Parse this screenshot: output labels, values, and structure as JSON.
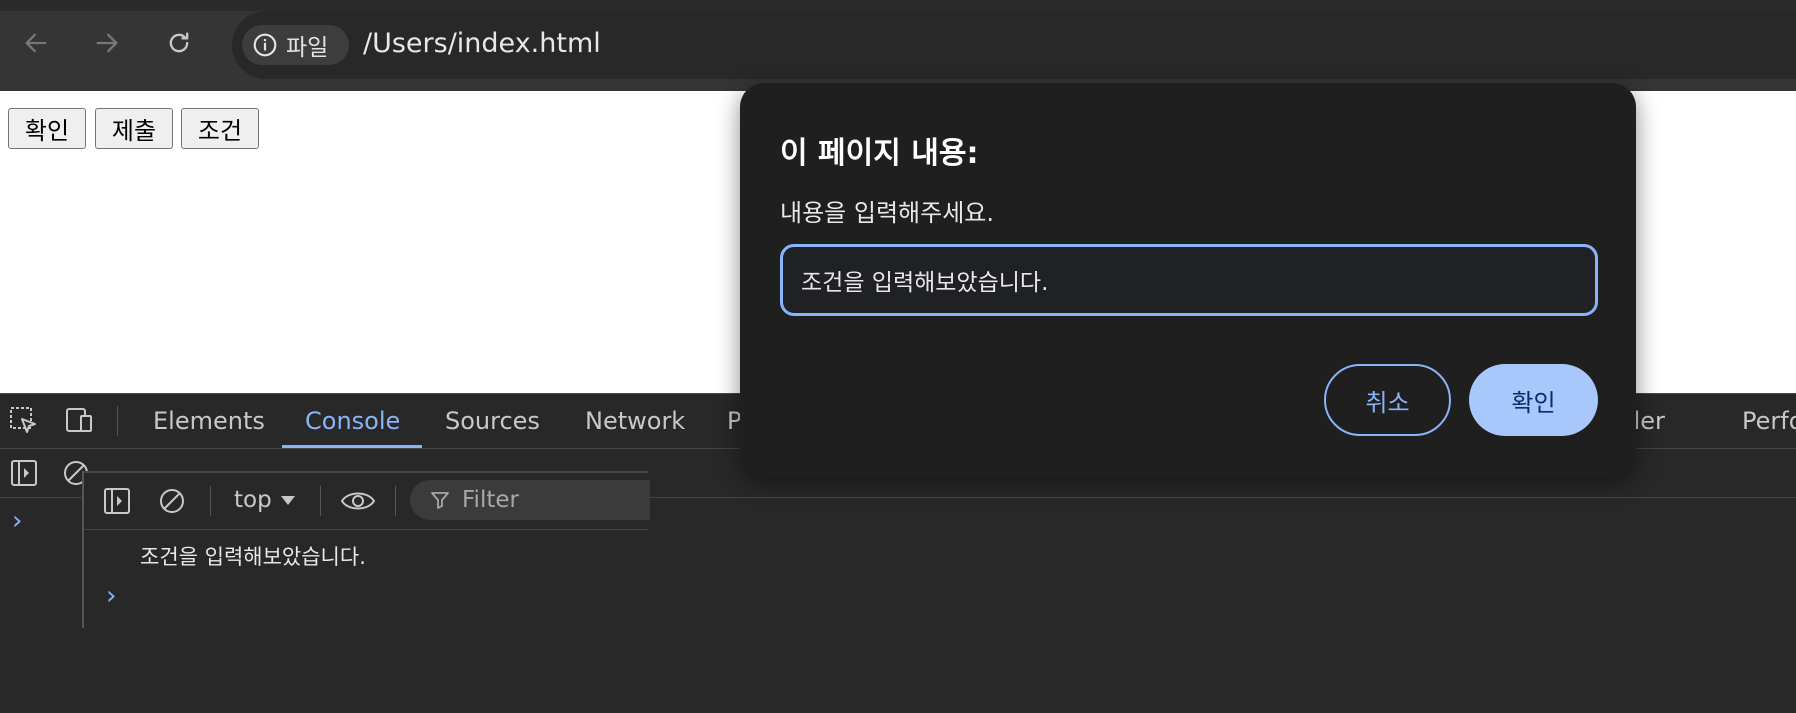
{
  "browser": {
    "back_icon": "arrow-left-icon",
    "forward_icon": "arrow-right-icon",
    "reload_icon": "reload-icon",
    "site_info": {
      "icon": "info-icon",
      "label": "파일"
    },
    "url": "/Users/index.html"
  },
  "page": {
    "buttons": [
      {
        "label": "확인"
      },
      {
        "label": "제출"
      },
      {
        "label": "조건"
      }
    ]
  },
  "devtools": {
    "tabs": [
      {
        "label": "Elements"
      },
      {
        "label": "Console",
        "active": true
      },
      {
        "label": "Sources"
      },
      {
        "label": "Network"
      },
      {
        "label": "P"
      },
      {
        "label": "der"
      },
      {
        "label": "Perfo"
      }
    ],
    "console": {
      "context": "top",
      "filter_placeholder": "Filter",
      "log": "조건을 입력해보았습니다."
    }
  },
  "dialog": {
    "title": "이 페이지 내용:",
    "message": "내용을 입력해주세요.",
    "input_value": "조건을 입력해보았습니다.",
    "cancel_label": "취소",
    "ok_label": "확인"
  },
  "colors": {
    "accent": "#8ab4f8",
    "ok_button": "#a8c7fa",
    "dialog_bg": "#1f1f1f"
  }
}
